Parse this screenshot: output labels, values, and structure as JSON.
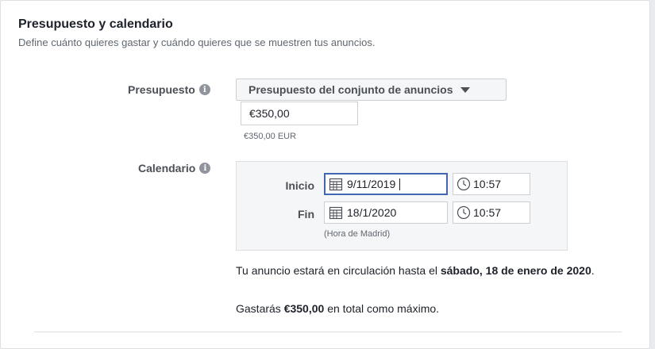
{
  "section": {
    "title": "Presupuesto y calendario",
    "subtitle": "Define cuánto quieres gastar y cuándo quieres que se muestren tus anuncios."
  },
  "budget": {
    "label": "Presupuesto",
    "info_icon": "info-icon",
    "type_dropdown": "Presupuesto del conjunto de anuncios",
    "amount_value": "€350,00",
    "amount_note": "€350,00 EUR"
  },
  "schedule": {
    "label": "Calendario",
    "info_icon": "info-icon",
    "start_label": "Inicio",
    "start_date": "9/11/2019",
    "start_time": "10:57",
    "end_label": "Fin",
    "end_date": "18/1/2020",
    "end_time": "10:57",
    "timezone_note": "(Hora de Madrid)"
  },
  "summary": {
    "run_prefix": "Tu anuncio estará en circulación hasta el ",
    "run_date": "sábado, 18 de enero de 2020",
    "run_suffix": ".",
    "spend_prefix": "Gastarás ",
    "spend_amount": "€350,00",
    "spend_suffix": " en total como máximo."
  },
  "colors": {
    "accent": "#4267b2",
    "border": "#ccd0d5",
    "muted_text": "#606770"
  }
}
